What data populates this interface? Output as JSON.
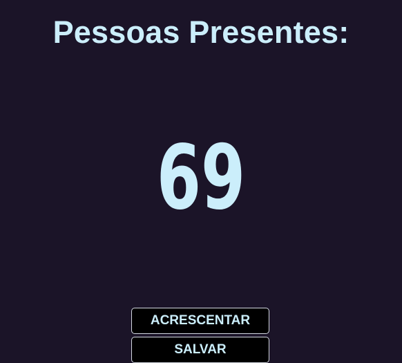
{
  "header": {
    "title": "Pessoas Presentes:"
  },
  "counter": {
    "value": "69"
  },
  "actions": {
    "add_label": "ACRESCENTAR",
    "save_label": "SALVAR"
  },
  "colors": {
    "background": "#1b1428",
    "text": "#cbeefb",
    "button_bg": "#000000",
    "button_border": "#d4d9e2"
  }
}
